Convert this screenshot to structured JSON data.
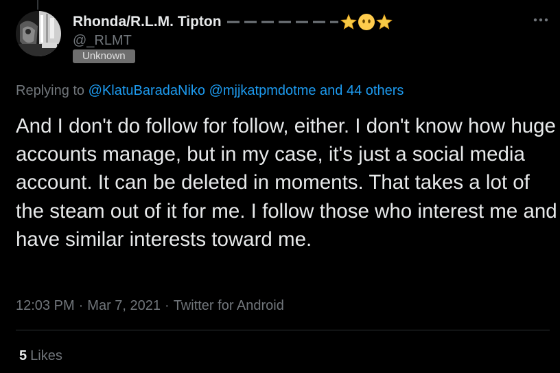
{
  "colors": {
    "background": "#000000",
    "text_primary": "#e7e9ea",
    "text_secondary": "#71767b",
    "link": "#1d9bf0",
    "divider": "#2f3336",
    "badge_bg": "#6e6e6e"
  },
  "author": {
    "display_name": "Rhonda/R.L.M. Tipton",
    "name_decorations": [
      "dashed-line",
      "star-emoji",
      "no-mouth-face-emoji",
      "star-emoji"
    ],
    "handle": "@_RLMT",
    "label": "Unknown",
    "avatar_icon": "avatar-photo"
  },
  "more_menu_icon": "more-dots-icon",
  "reply_context": {
    "prefix": "Replying to",
    "mention_1": "@KlatuBaradaNiko",
    "mention_2": "@mjjkatpmdotme",
    "and_others": "and 44 others"
  },
  "tweet": {
    "text": "And I don't do follow for follow, either. I don't know how huge accounts manage, but in my case, it's just a social media account. It can be deleted in moments. That takes a lot of the steam out of it for me. I follow those who interest me and have similar interests toward me."
  },
  "meta": {
    "time": "12:03 PM",
    "separator": "·",
    "date": "Mar 7, 2021",
    "source": "Twitter for Android"
  },
  "stats": {
    "likes_count": "5",
    "likes_label": "Likes"
  }
}
